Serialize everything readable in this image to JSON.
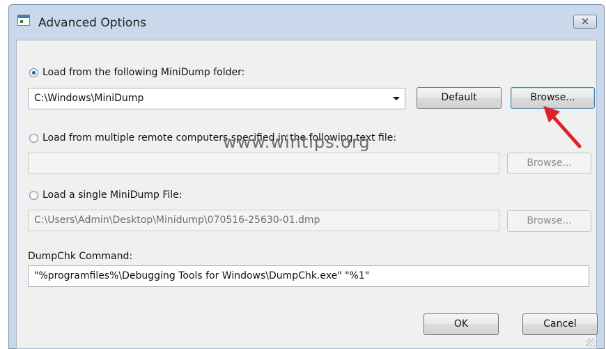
{
  "window": {
    "title": "Advanced Options",
    "close_label": "✕"
  },
  "options": {
    "minidump_folder": {
      "label": "Load from the following MiniDump folder:",
      "selected": true,
      "value": "C:\\Windows\\MiniDump",
      "default_button": "Default",
      "browse_button": "Browse..."
    },
    "remote_computers": {
      "label": "Load from multiple remote computers specified in the following text file:",
      "selected": false,
      "value": "",
      "browse_button": "Browse..."
    },
    "single_file": {
      "label": "Load a single MiniDump File:",
      "selected": false,
      "value": "C:\\Users\\Admin\\Desktop\\Minidump\\070516-25630-01.dmp",
      "browse_button": "Browse..."
    }
  },
  "dumpchk": {
    "label": "DumpChk Command:",
    "value": "\"%programfiles%\\Debugging Tools for Windows\\DumpChk.exe\" \"%1\""
  },
  "footer": {
    "ok": "OK",
    "cancel": "Cancel"
  },
  "watermark": "www.wintips.org",
  "colors": {
    "annotation_arrow": "#e0202a",
    "window_frame": "#c9d8ea"
  }
}
